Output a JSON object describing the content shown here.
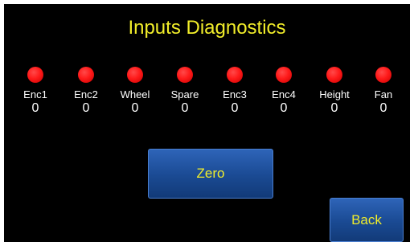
{
  "screen": {
    "title": "Inputs Diagnostics",
    "title_color": "#f2ee2a",
    "background": "#000000"
  },
  "inputs": [
    {
      "label": "Enc1",
      "value": "0",
      "indicator_color": "#ff1a1a"
    },
    {
      "label": "Enc2",
      "value": "0",
      "indicator_color": "#ff1a1a"
    },
    {
      "label": "Wheel",
      "value": "0",
      "indicator_color": "#ff1a1a"
    },
    {
      "label": "Spare",
      "value": "0",
      "indicator_color": "#ff1a1a"
    },
    {
      "label": "Enc3",
      "value": "0",
      "indicator_color": "#ff1a1a"
    },
    {
      "label": "Enc4",
      "value": "0",
      "indicator_color": "#ff1a1a"
    },
    {
      "label": "Height",
      "value": "0",
      "indicator_color": "#ff1a1a"
    },
    {
      "label": "Fan",
      "value": "0",
      "indicator_color": "#ff1a1a"
    }
  ],
  "buttons": {
    "zero_label": "Zero",
    "back_label": "Back",
    "button_color": "#1a4a93"
  }
}
